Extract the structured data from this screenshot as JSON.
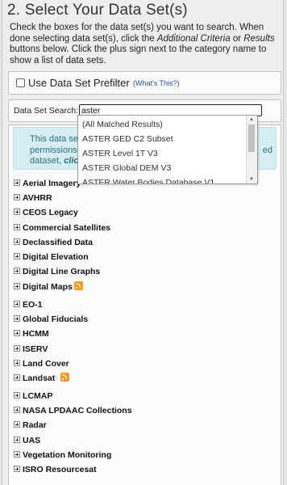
{
  "heading": "2. Select Your Data Set(s)",
  "instructions": {
    "p1": "Check the boxes for the data set(s) you want to search. When done selecting data set(s), click the ",
    "crit": "Additional Criteria",
    "or": " or ",
    "res": "Results",
    "p2": " buttons below. Click the plus sign next to the category name to show a list of data sets."
  },
  "prefilter": {
    "label": "Use Data Set Prefilter",
    "whats_this": "(What's This?)",
    "checked": false
  },
  "search": {
    "label": "Data Set Search:",
    "value": "aster"
  },
  "dropdown": [
    "(All Matched Results)",
    "ASTER GED C2 Subset",
    "ASTER Level 1T V3",
    "ASTER Global DEM V3",
    "ASTER Water Bodies Database V1"
  ],
  "notice": {
    "line1": "This data set",
    "line2": "permissions h",
    "line3_plain": "dataset, ",
    "line3_bold": "click",
    "right": "ed"
  },
  "categories": [
    {
      "label": "Aerial Imagery",
      "rss": false
    },
    {
      "label": "AVHRR",
      "rss": false
    },
    {
      "label": "CEOS Legacy",
      "rss": false
    },
    {
      "label": "Commercial Satellites",
      "rss": false
    },
    {
      "label": "Declassified Data",
      "rss": false
    },
    {
      "label": "Digital Elevation",
      "rss": false
    },
    {
      "label": "Digital Line Graphs",
      "rss": false
    },
    {
      "label": "Digital Maps",
      "rss": true
    },
    {
      "label": "EO-1",
      "rss": false
    },
    {
      "label": "Global Fiducials",
      "rss": false
    },
    {
      "label": "HCMM",
      "rss": false
    },
    {
      "label": "ISERV",
      "rss": false
    },
    {
      "label": "Land Cover",
      "rss": false
    },
    {
      "label": "Landsat",
      "rss": true
    },
    {
      "label": "LCMAP",
      "rss": false
    },
    {
      "label": "NASA LPDAAC Collections",
      "rss": false
    },
    {
      "label": "Radar",
      "rss": false
    },
    {
      "label": "UAS",
      "rss": false
    },
    {
      "label": "Vegetation Monitoring",
      "rss": false
    },
    {
      "label": "ISRO Resourcesat",
      "rss": false
    }
  ]
}
